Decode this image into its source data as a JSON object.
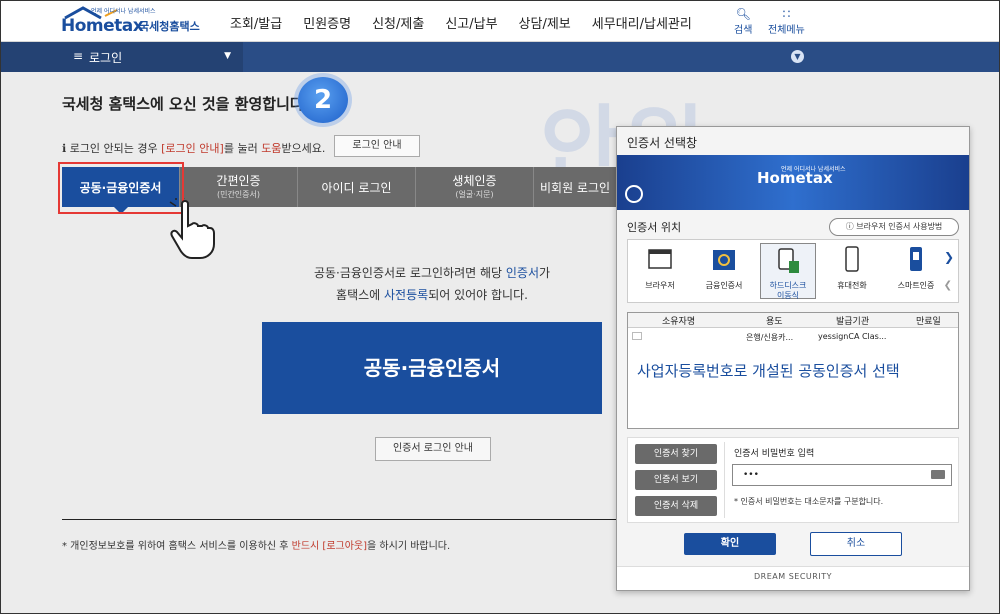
{
  "header": {
    "logo_text": "Hometax",
    "logo_subtitle": "국세청홈택스",
    "logo_tagline": "언제 어디서나 납세서비스",
    "nav": [
      "조회/발급",
      "민원증명",
      "신청/제출",
      "신고/납부",
      "상담/제보",
      "세무대리/납세관리"
    ],
    "search_label": "검색",
    "all_menu_label": "전체메뉴"
  },
  "subbar": {
    "menu_label": "로그인"
  },
  "main": {
    "welcome": "국세청 홈택스에 오신 것을 환영합니다.",
    "step_badge": "2",
    "notice_prefix": "로그인 안되는 경우 ",
    "notice_link": "[로그인 안내]",
    "notice_mid": "를 눌러 ",
    "notice_help": "도움",
    "notice_suffix": "받으세요.",
    "notice_button": "로그인 안내",
    "tabs": [
      {
        "label": "공동·금융인증서",
        "sub": ""
      },
      {
        "label": "간편인증",
        "sub": "(민간인증서)"
      },
      {
        "label": "아이디 로그인",
        "sub": ""
      },
      {
        "label": "생체인증",
        "sub": "(얼굴·지문)"
      },
      {
        "label": "비회원 로그인",
        "sub": ""
      }
    ],
    "desc_line1_a": "공동·금융인증서로 로그인하려면 해당 ",
    "desc_line1_b": "인증서",
    "desc_line1_c": "가",
    "desc_line2_a": "홈택스에 ",
    "desc_line2_b": "사전등록",
    "desc_line2_c": "되어 있어야 합니다.",
    "big_button": "공동·금융인증서",
    "guide_button": "인증서 로그인 안내",
    "footnote_a": "* 개인정보보호를 위하여 홈택스 서비스를 이용하신 후 ",
    "footnote_b": "반드시 [로그아웃]",
    "footnote_c": "을 하시기 바랍니다."
  },
  "dialog": {
    "title": "인증서 선택창",
    "banner_logo": "Hometax",
    "banner_tagline": "언제 어디서나 납세서비스",
    "location_label": "인증서 위치",
    "browser_help": "브라우저 인증서 사용방법",
    "devices": [
      {
        "label": "브라우저",
        "icon": "browser-icon"
      },
      {
        "label": "금융인증서",
        "icon": "finance-cert-icon"
      },
      {
        "label": "하드디스크\n이동식",
        "icon": "harddisk-icon"
      },
      {
        "label": "휴대전화",
        "icon": "phone-icon"
      },
      {
        "label": "스마트인증",
        "icon": "smart-cert-icon"
      }
    ],
    "table_headers": [
      "소유자명",
      "용도",
      "발급기관",
      "만료일"
    ],
    "row": {
      "usage": "은행/신용카...",
      "issuer": "yessignCA Clas..."
    },
    "overlay": "사업자등록번호로 개설된 공동인증서 선택",
    "buttons": [
      "인증서 찾기",
      "인증서 보기",
      "인증서 삭제"
    ],
    "pw_label": "인증서 비밀번호 입력",
    "pw_value": "•••",
    "pw_hint": "* 인증서 비밀번호는 대소문자를 구분합니다.",
    "ok": "확인",
    "cancel": "취소",
    "footer": "DREAM SECURITY"
  },
  "colors": {
    "brand": "#1a4e9e",
    "highlight": "#e53935",
    "tab_gray": "#6a6a6a"
  }
}
